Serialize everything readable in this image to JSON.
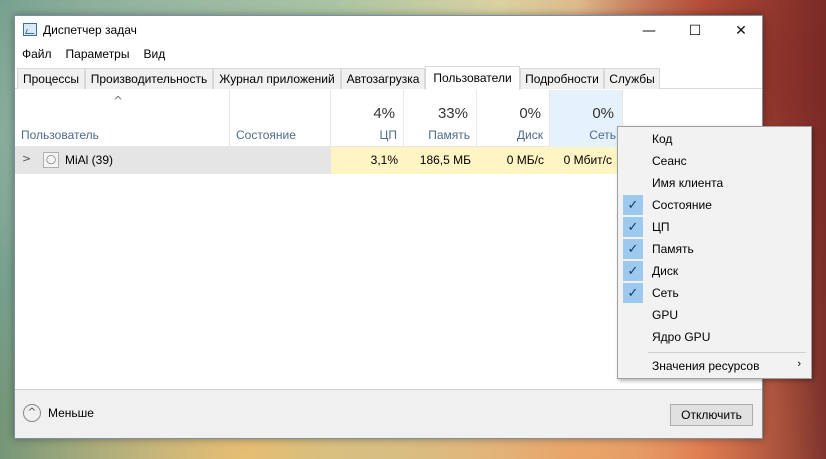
{
  "window": {
    "title": "Диспетчер задач",
    "buttons": {
      "minimize": "—",
      "maximize": "☐",
      "close": "✕"
    }
  },
  "menu": [
    "Файл",
    "Параметры",
    "Вид"
  ],
  "tabs": [
    "Процессы",
    "Производительность",
    "Журнал приложений",
    "Автозагрузка",
    "Пользователи",
    "Подробности",
    "Службы"
  ],
  "active_tab": "Пользователи",
  "columns": {
    "user": "Пользователь",
    "status": "Состояние",
    "cpu": {
      "pct": "4%",
      "label": "ЦП"
    },
    "memory": {
      "pct": "33%",
      "label": "Память"
    },
    "disk": {
      "pct": "0%",
      "label": "Диск"
    },
    "network": {
      "pct": "0%",
      "label": "Сеть"
    }
  },
  "rows": [
    {
      "user": "MiAl (39)",
      "status": "",
      "cpu": "3,1%",
      "memory": "186,5 МБ",
      "disk": "0 МБ/с",
      "network": "0 Мбит/с"
    }
  ],
  "footer": {
    "less_label": "Меньше",
    "disconnect_label": "Отключить"
  },
  "context_menu": {
    "items": [
      {
        "label": "Код",
        "checked": false
      },
      {
        "label": "Сеанс",
        "checked": false
      },
      {
        "label": "Имя клиента",
        "checked": false
      },
      {
        "label": "Состояние",
        "checked": true
      },
      {
        "label": "ЦП",
        "checked": true
      },
      {
        "label": "Память",
        "checked": true
      },
      {
        "label": "Диск",
        "checked": true
      },
      {
        "label": "Сеть",
        "checked": true
      },
      {
        "label": "GPU",
        "checked": false
      },
      {
        "label": "Ядро GPU",
        "checked": false
      }
    ],
    "submenu_label": "Значения ресурсов"
  },
  "colors": {
    "accent_check": "#9ec9ef",
    "header_label": "#4d6a8a",
    "heat_cell": "#fff4c4"
  }
}
